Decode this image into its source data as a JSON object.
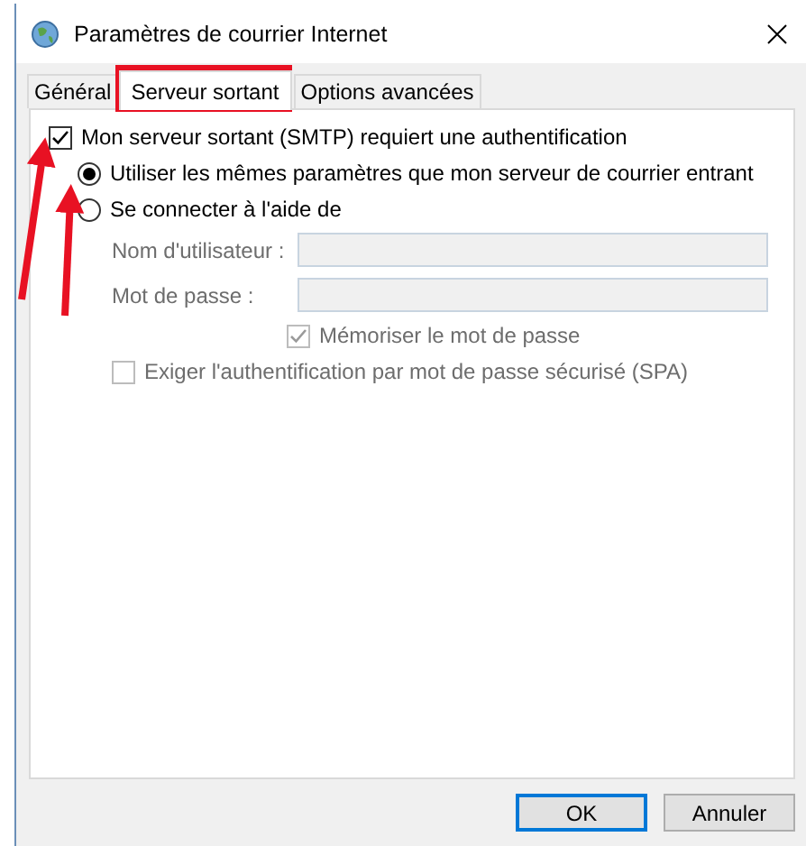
{
  "window": {
    "title": "Paramètres de courrier Internet"
  },
  "tabs": [
    {
      "label": "Général",
      "selected": false
    },
    {
      "label": "Serveur sortant",
      "selected": true
    },
    {
      "label": "Options avancées",
      "selected": false
    }
  ],
  "auth": {
    "label": "Mon serveur sortant (SMTP) requiert une authentification",
    "checked": true
  },
  "options": [
    {
      "label": "Utiliser les mêmes paramètres que mon serveur de courrier entrant",
      "selected": true
    },
    {
      "label": "Se connecter à l'aide de",
      "selected": false
    }
  ],
  "fields": [
    {
      "label": "Nom d'utilisateur :",
      "disabled": true
    },
    {
      "label": "Mot de passe :",
      "disabled": true
    }
  ],
  "remember": {
    "label": "Mémoriser le mot de passe",
    "checked": true,
    "disabled": true
  },
  "spa": {
    "label": "Exiger l'authentification par mot de passe sécurisé (SPA)",
    "checked": false,
    "disabled": true
  },
  "buttons": [
    {
      "label": "OK",
      "default": true
    },
    {
      "label": "Annuler",
      "default": false
    }
  ]
}
